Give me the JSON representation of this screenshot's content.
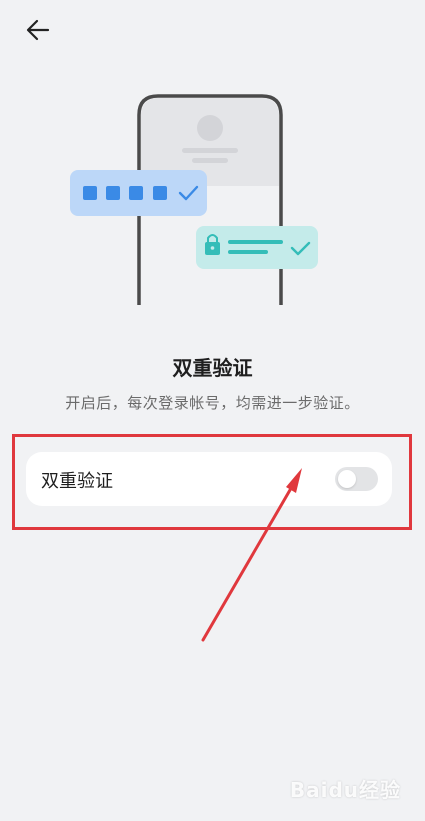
{
  "header": {
    "back_icon": "arrow-left-icon"
  },
  "hero": {
    "title": "双重验证",
    "description": "开启后，每次登录帐号，均需进一步验证。"
  },
  "setting": {
    "label": "双重验证",
    "toggle_state": "off"
  },
  "colors": {
    "background": "#f1f2f4",
    "highlight": "#e0383d",
    "code_card": "#bcd7f8",
    "code_dot": "#3a8ae6",
    "password_card": "#c4ebea",
    "password_accent": "#34bdb8"
  },
  "watermark": {
    "text": "Baidu经验"
  }
}
